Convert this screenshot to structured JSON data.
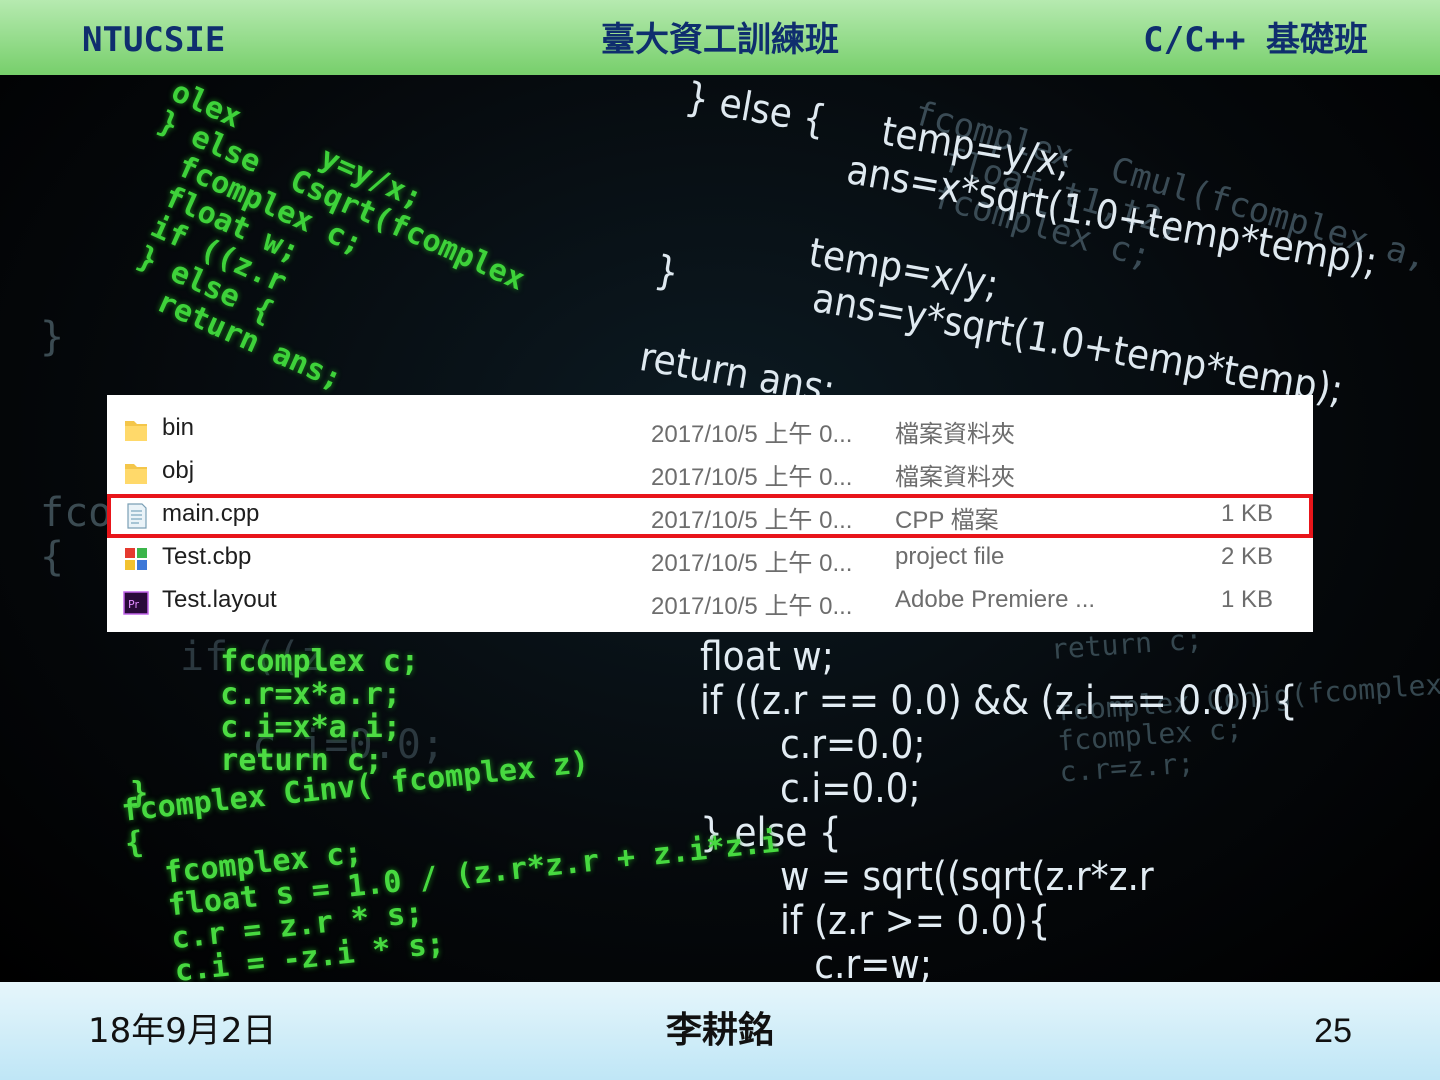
{
  "header": {
    "left": "NTUCSIE",
    "center": "臺大資工訓練班",
    "right": "C/C++ 基礎班"
  },
  "background_code": {
    "block1": "olex     y=y/x;\n} else  Csqrt(fcomplex\n  fcomplex c;\n  float w;\n  if ((z.r\n  } else {\n    return ans;",
    "block2": "} else {     temp=y/x;\n               ans=x*sqrt(1.0+temp*temp);\n\n             temp=x/y;\n}            ans=y*sqrt(1.0+temp*temp);\n\nreturn ans;",
    "block3": "fcomplex  Cmul(fcomplex a,\n  float t1,t2;\n  fcomplex c;",
    "block4": "}\n\n\n\nfcom\n{",
    "block5": "     fcomplex c;\n     c.r=x*a.r;\n     c.i=x*a.i;\n     return c;\n}",
    "block6": "float w;\nif ((z.r == 0.0) && (z.i == 0.0)) {\n       c.r=0.0;\n       c.i=0.0;\n} else {\n       w = sqrt((sqrt(z.r*z.r\n       if (z.r >= 0.0){\n          c.r=w;",
    "block7": "if ((z\n\n   c.i=0.0;",
    "block8": "return c;\n\nfcomplex Conjg(fcomplex z)\nfcomplex c;\nc.r=z.r;",
    "block9": "fcomplex Cinv( fcomplex z)\n{\n  fcomplex c;\n  float s = 1.0 / (z.r*z.r + z.i*z.i\n  c.r = z.r * s;\n  c.i = -z.i * s;"
  },
  "file_list": {
    "rows": [
      {
        "name": "bin",
        "date": "2017/10/5 上午 0...",
        "type": "檔案資料夾",
        "size": "",
        "icon": "folder-icon"
      },
      {
        "name": "obj",
        "date": "2017/10/5 上午 0...",
        "type": "檔案資料夾",
        "size": "",
        "icon": "folder-icon"
      },
      {
        "name": "main.cpp",
        "date": "2017/10/5 上午 0...",
        "type": "CPP 檔案",
        "size": "1 KB",
        "icon": "cpp-file-icon"
      },
      {
        "name": "Test.cbp",
        "date": "2017/10/5 上午 0...",
        "type": "project file",
        "size": "2 KB",
        "icon": "codeblocks-project-icon"
      },
      {
        "name": "Test.layout",
        "date": "2017/10/5 上午 0...",
        "type": "Adobe Premiere ...",
        "size": "1 KB",
        "icon": "premiere-file-icon"
      }
    ],
    "highlight_color": "#e8151a"
  },
  "footer": {
    "left": "18年9月2日",
    "center": "李耕銘",
    "right": "25"
  }
}
